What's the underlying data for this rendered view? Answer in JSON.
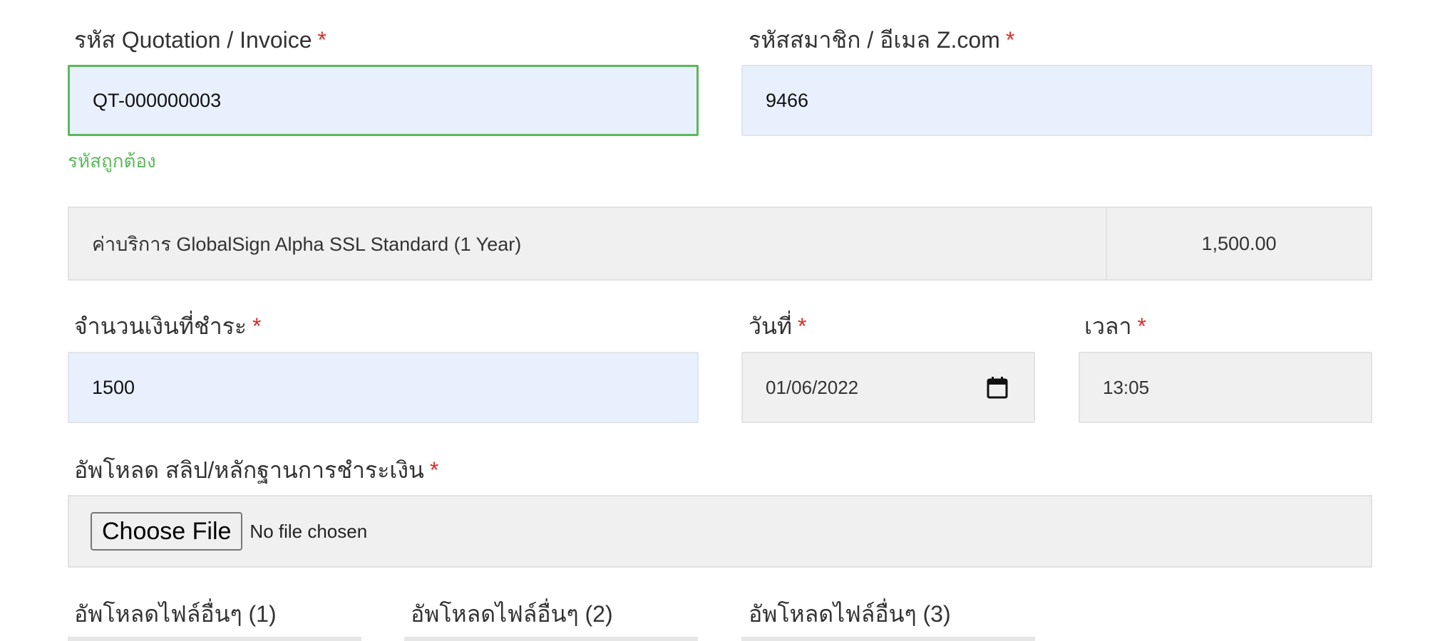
{
  "form": {
    "quotation": {
      "label": "รหัส Quotation / Invoice",
      "required": "*",
      "value": "QT-000000003",
      "helper": "รหัสถูกต้อง"
    },
    "member": {
      "label": "รหัสสมาชิก / อีเมล Z.com",
      "required": "*",
      "value": "9466"
    },
    "service": {
      "description": "ค่าบริการ GlobalSign Alpha SSL Standard (1 Year)",
      "price": "1,500.00"
    },
    "amount": {
      "label": "จำนวนเงินที่ชำระ",
      "required": "*",
      "value": "1500"
    },
    "date": {
      "label": "วันที่",
      "required": "*",
      "value": "01/06/2022",
      "icon": "calendar-icon"
    },
    "time": {
      "label": "เวลา",
      "required": "*",
      "value": "13:05"
    },
    "upload_slip": {
      "label": "อัพโหลด สลิป/หลักฐานการชำระเงิน",
      "required": "*",
      "button": "Choose File",
      "status": "No file chosen"
    },
    "other_uploads": [
      {
        "label": "อัพโหลดไฟล์อื่นๆ (1)"
      },
      {
        "label": "อัพโหลดไฟล์อื่นๆ (2)"
      },
      {
        "label": "อัพโหลดไฟล์อื่นๆ (3)"
      }
    ]
  },
  "colors": {
    "required": "#e02a2a",
    "valid": "#5cb85c",
    "autofill_bg": "#e8f0fe",
    "readonly_bg": "#f0f0f0"
  }
}
